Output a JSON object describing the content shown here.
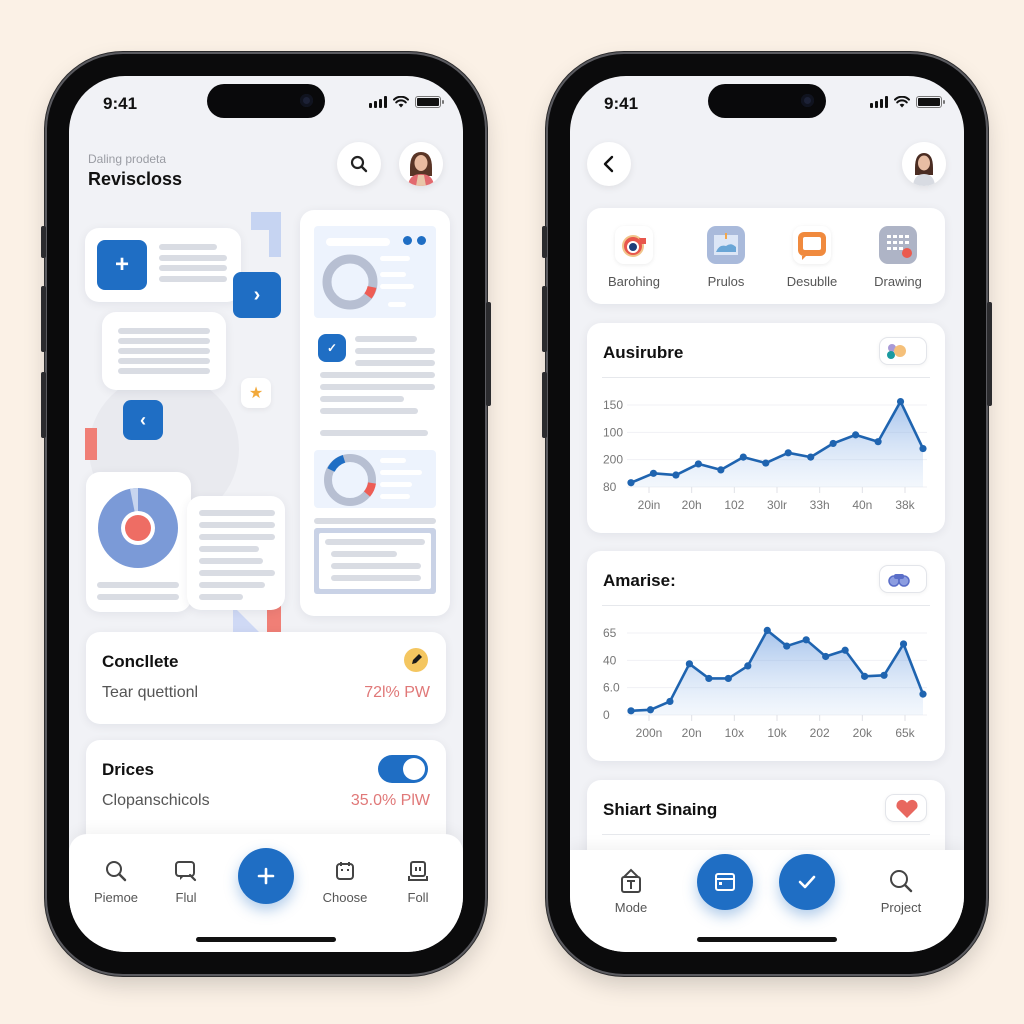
{
  "left_phone": {
    "status": {
      "time": "9:41"
    },
    "header": {
      "subtitle": "Daling prodeta",
      "title": "Reviscloss"
    },
    "cards": [
      {
        "title": "Concllete",
        "subtitle": "Tear quettionl",
        "value": "72l% PW",
        "icon": "pencil-badge-icon"
      },
      {
        "title": "Drices",
        "subtitle": "Clopanschicols",
        "value": "35.0% PlW",
        "toggle_on": true
      }
    ],
    "tabbar": {
      "items": [
        {
          "label": "Piemoe",
          "icon": "search-icon"
        },
        {
          "label": "Flul",
          "icon": "chat-search-icon"
        },
        {
          "label": "",
          "icon": "plus-icon"
        },
        {
          "label": "Choose",
          "icon": "calendar-icon"
        },
        {
          "label": "Foll",
          "icon": "archive-icon"
        }
      ]
    }
  },
  "right_phone": {
    "status": {
      "time": "9:41"
    },
    "quick_actions": [
      {
        "label": "Barohing",
        "icon": "camera-icon"
      },
      {
        "label": "Prulos",
        "icon": "image-icon"
      },
      {
        "label": "Desublle",
        "icon": "message-icon"
      },
      {
        "label": "Drawing",
        "icon": "grid-icon"
      }
    ],
    "charts_titles": [
      "Ausirubre",
      "Amarise:"
    ],
    "section3_title": "Shiart Sinaing",
    "tabbar": {
      "items": [
        {
          "label": "Mode",
          "icon": "share-box-icon"
        },
        {
          "label": "",
          "icon": "window-icon"
        },
        {
          "label": "",
          "icon": "check-icon"
        },
        {
          "label": "Project",
          "icon": "search-icon"
        }
      ]
    }
  },
  "chart_data": [
    {
      "type": "area",
      "title": "Ausirubre",
      "y_tick_labels": [
        "150",
        "100",
        "200",
        "80"
      ],
      "x_tick_labels": [
        "20in",
        "20h",
        "102",
        "30lr",
        "33h",
        "40n",
        "38k"
      ],
      "values": [
        30,
        41,
        39,
        52,
        45,
        60,
        53,
        65,
        60,
        76,
        86,
        78,
        125,
        70
      ],
      "ylim": [
        25,
        135
      ],
      "grid": true
    },
    {
      "type": "area",
      "title": "Amarise:",
      "y_tick_labels": [
        "65",
        "40",
        "6.0",
        "0"
      ],
      "x_tick_labels": [
        "200n",
        "20n",
        "10x",
        "10k",
        "202",
        "20k",
        "65k"
      ],
      "values": [
        4,
        5,
        13,
        49,
        35,
        35,
        47,
        81,
        66,
        72,
        56,
        62,
        37,
        38,
        68,
        20
      ],
      "ylim": [
        0,
        90
      ],
      "grid": true
    }
  ]
}
